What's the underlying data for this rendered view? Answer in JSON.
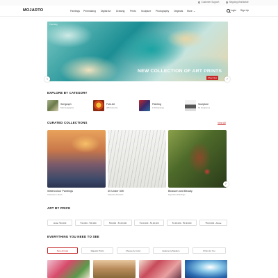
{
  "topbar": {
    "customer_support": "Customer Support",
    "shipping": "Shipping Worldwide"
  },
  "header": {
    "logo_main": "MOJARTO",
    "nav": [
      "Paintings",
      "Printmaking",
      "Digital Art",
      "Drawing",
      "Prints",
      "Sculpture",
      "Photography",
      "Originals",
      "More"
    ],
    "login": "Login",
    "signup": "Sign Up"
  },
  "hero": {
    "tag": "Trending",
    "title": "NEW COLLECTION OF ART PRINTS",
    "button": "Shop Now",
    "prev": "‹",
    "next": "›"
  },
  "categories": {
    "title": "EXPLORE BY CATEGORY",
    "items": [
      {
        "name": "Serigraph",
        "count": "540 Serigraphs"
      },
      {
        "name": "Folk Art",
        "count": "285 Folk Arts"
      },
      {
        "name": "Painting",
        "count": "178 Paintings"
      },
      {
        "name": "Sculpture",
        "count": "66 Sculptures"
      }
    ]
  },
  "collections": {
    "title": "CURATED COLLECTIONS",
    "view_all": "View All",
    "items": [
      {
        "name": "Watercolour Paintings",
        "sub": "Artworks in Stock"
      },
      {
        "name": "30 Under 30K",
        "sub": "Selected Artworks"
      },
      {
        "name": "Blossom and Beauty",
        "sub": "Figurative Paintings"
      }
    ]
  },
  "price": {
    "title": "ART BY PRICE",
    "pills": [
      "Under ₹10,000",
      "₹10,000 - ₹30,000",
      "₹30,000 - ₹1,00,000",
      "₹1,00,000 - ₹2,00,000",
      "₹2,00,000 - ₹5,00,000",
      "₹5,00,000 - Above"
    ]
  },
  "everything": {
    "title": "EVERYTHING YOU NEED TO SEE",
    "tabs": [
      "New Arrivals",
      "Majestic Prints",
      "Choose by Color",
      "Explore by Medium",
      "Prints for You"
    ]
  }
}
